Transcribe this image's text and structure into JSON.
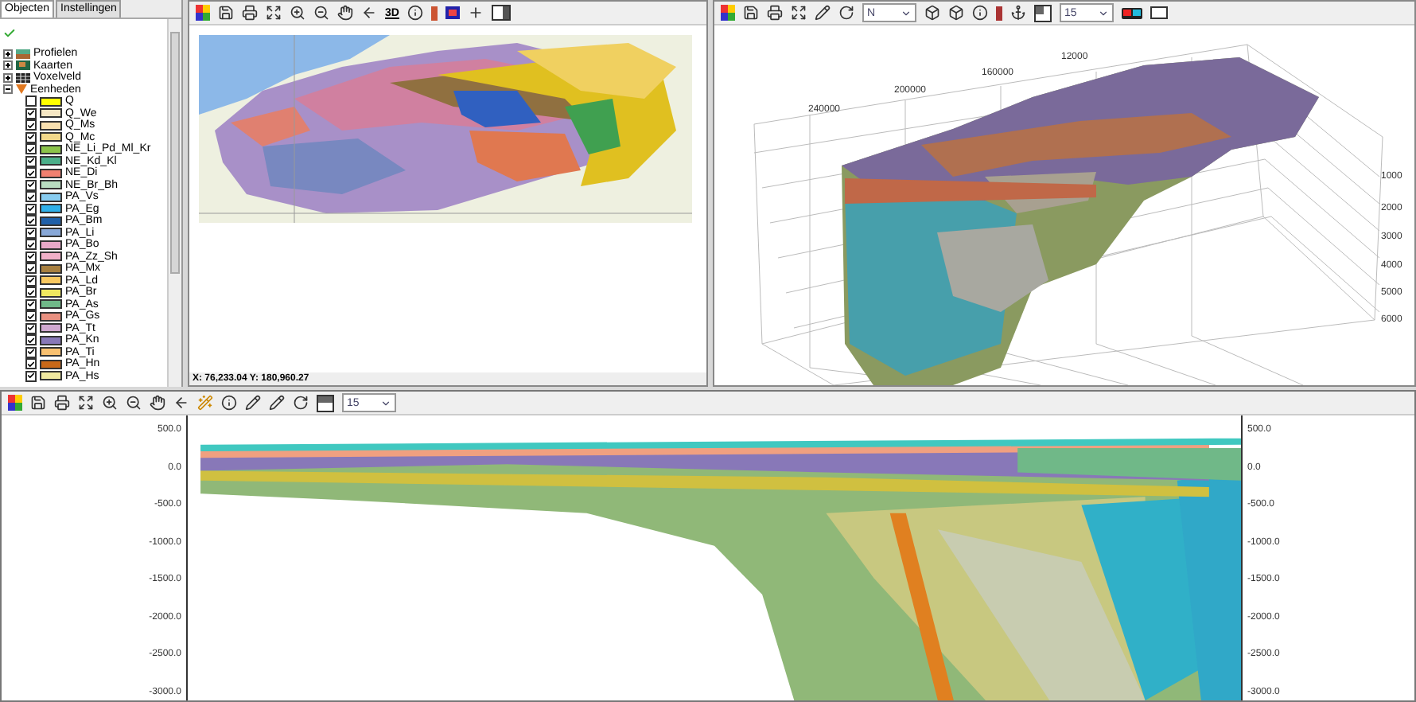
{
  "tree_tabs": [
    {
      "label": "Objecten",
      "selected": true
    },
    {
      "label": "Instellingen",
      "selected": false
    }
  ],
  "tree": [
    {
      "label": "Profielen",
      "kind": "profile",
      "expanded": false
    },
    {
      "label": "Kaarten",
      "kind": "map",
      "expanded": false
    },
    {
      "label": "Voxelveld",
      "kind": "grid",
      "expanded": false
    },
    {
      "label": "Eenheden",
      "kind": "units",
      "expanded": true,
      "children": [
        {
          "label": "Q",
          "checked": false,
          "color": "#ffff00"
        },
        {
          "label": "Q_We",
          "checked": true,
          "color": "#f6e7c4"
        },
        {
          "label": "Q_Ms",
          "checked": true,
          "color": "#f8e0b0"
        },
        {
          "label": "Q_Mc",
          "checked": true,
          "color": "#f2d88a"
        },
        {
          "label": "NE_Li_Pd_Ml_Kr",
          "checked": true,
          "color": "#8bc34a"
        },
        {
          "label": "NE_Kd_Kl",
          "checked": true,
          "color": "#4caf8a"
        },
        {
          "label": "NE_Di",
          "checked": true,
          "color": "#f08070"
        },
        {
          "label": "NE_Br_Bh",
          "checked": true,
          "color": "#b8dcc0"
        },
        {
          "label": "PA_Vs",
          "checked": true,
          "color": "#88ccf0"
        },
        {
          "label": "PA_Eg",
          "checked": true,
          "color": "#30b0e8"
        },
        {
          "label": "PA_Bm",
          "checked": true,
          "color": "#2060a8"
        },
        {
          "label": "PA_Li",
          "checked": true,
          "color": "#88a8d8"
        },
        {
          "label": "PA_Bo",
          "checked": true,
          "color": "#e8a8c8"
        },
        {
          "label": "PA_Zz_Sh",
          "checked": true,
          "color": "#f0b0c8"
        },
        {
          "label": "PA_Mx",
          "checked": true,
          "color": "#a88040"
        },
        {
          "label": "PA_Ld",
          "checked": true,
          "color": "#f8c860"
        },
        {
          "label": "PA_Br",
          "checked": true,
          "color": "#f0e860"
        },
        {
          "label": "PA_As",
          "checked": true,
          "color": "#70b888"
        },
        {
          "label": "PA_Gs",
          "checked": true,
          "color": "#e89080"
        },
        {
          "label": "PA_Tt",
          "checked": true,
          "color": "#d0a8d0"
        },
        {
          "label": "PA_Kn",
          "checked": true,
          "color": "#8878b8"
        },
        {
          "label": "PA_Ti",
          "checked": true,
          "color": "#f8c070"
        },
        {
          "label": "PA_Hn",
          "checked": true,
          "color": "#c86818"
        },
        {
          "label": "PA_Hs",
          "checked": true,
          "color": "#f0e8a0"
        }
      ]
    }
  ],
  "map_panel": {
    "view3d_button": "3D",
    "coordinates": "X: 76,233.04 Y: 180,960.27"
  },
  "view3d": {
    "direction_select": "N",
    "size_select": "15",
    "x_ticks": [
      "240000",
      "200000",
      "160000",
      "12000"
    ],
    "z_ticks": [
      "1000",
      "2000",
      "3000",
      "4000",
      "5000",
      "6000"
    ]
  },
  "section": {
    "size_select": "15",
    "left_ticks": [
      "500.0",
      "0.0",
      "-500.0",
      "-1000.0",
      "-1500.0",
      "-2000.0",
      "-2500.0",
      "-3000.0"
    ],
    "right_ticks": [
      "500.0",
      "0.0",
      "-500.0",
      "-1000.0",
      "-1500.0",
      "-2000.0",
      "-2500.0",
      "-3000.0"
    ]
  }
}
